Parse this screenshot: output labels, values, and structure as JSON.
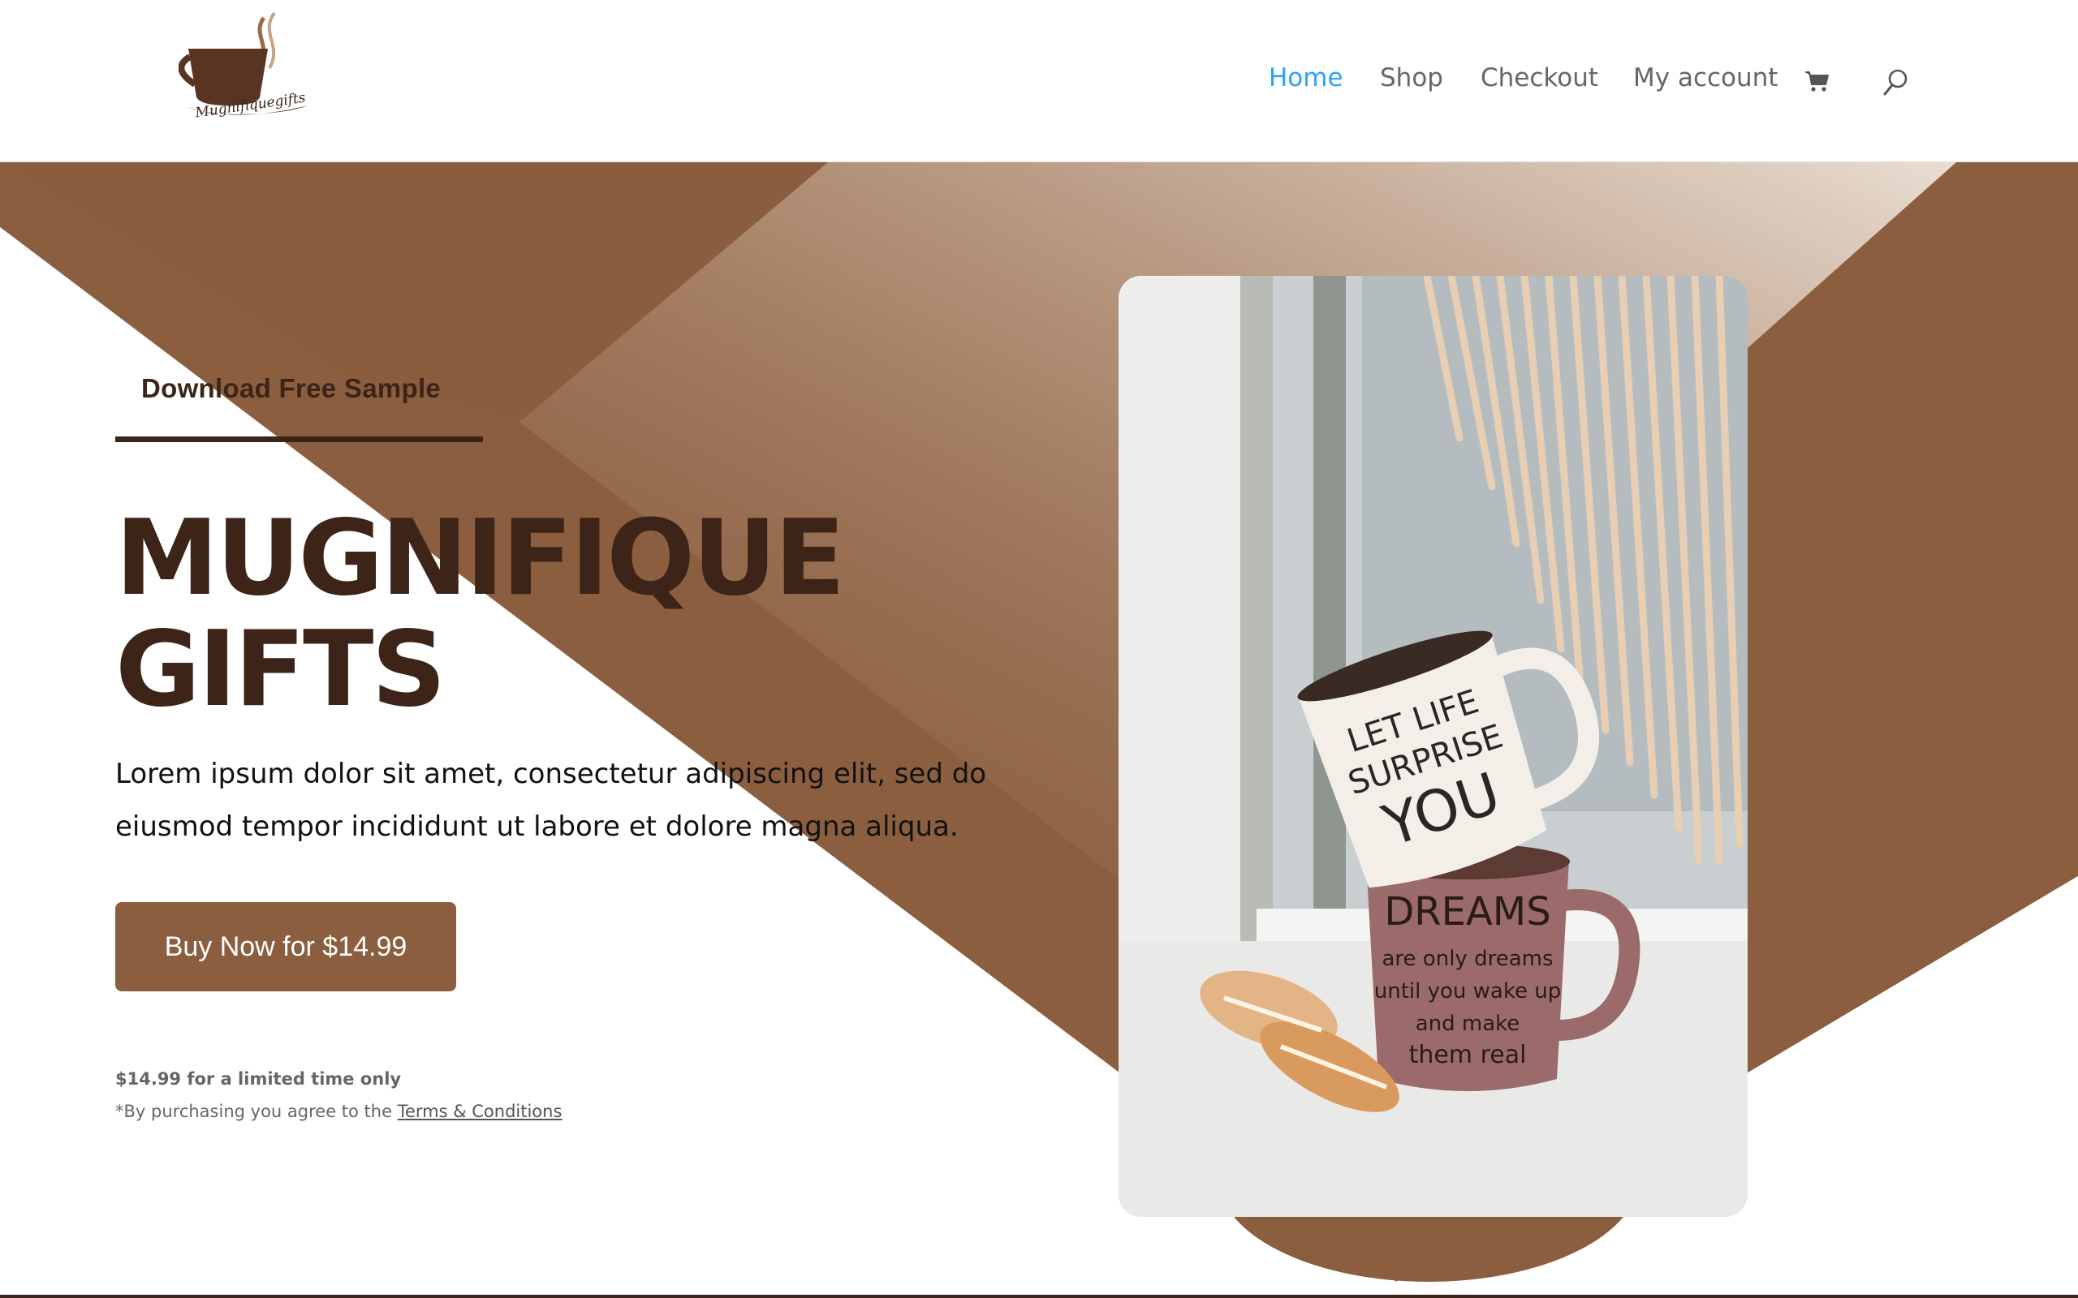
{
  "header": {
    "logo_text": "Mugnifiquegifts",
    "nav": [
      {
        "label": "Home",
        "active": true
      },
      {
        "label": "Shop",
        "active": false
      },
      {
        "label": "Checkout",
        "active": false
      },
      {
        "label": "My account",
        "active": false
      }
    ],
    "icons": [
      "cart-icon",
      "search-icon"
    ]
  },
  "hero": {
    "kicker": "Download Free Sample",
    "title_line1": "MUGNIFIQUE",
    "title_line2": "GIFTS",
    "description": "Lorem ipsum dolor sit amet, consectetur adipiscing elit, sed do eiusmod tempor incididunt ut labore et dolore magna aliqua.",
    "buy_button": "Buy Now for $14.99",
    "note_price": "$14.99 for a limited time only",
    "note_terms_prefix": "*By purchasing you agree to the ",
    "note_terms_link": "Terms & Conditions"
  },
  "photo": {
    "mug_top_text": [
      "LET LIFE",
      "SURPRISE",
      "YOU"
    ],
    "mug_bottom_text": [
      "DREAMS",
      "are only dreams",
      "until you wake up",
      "and make",
      "them real"
    ]
  },
  "colors": {
    "brand_brown": "#8b5e3f",
    "dark_brown": "#3d2418",
    "nav_active": "#2ea3f2",
    "nav_text": "#666666"
  }
}
